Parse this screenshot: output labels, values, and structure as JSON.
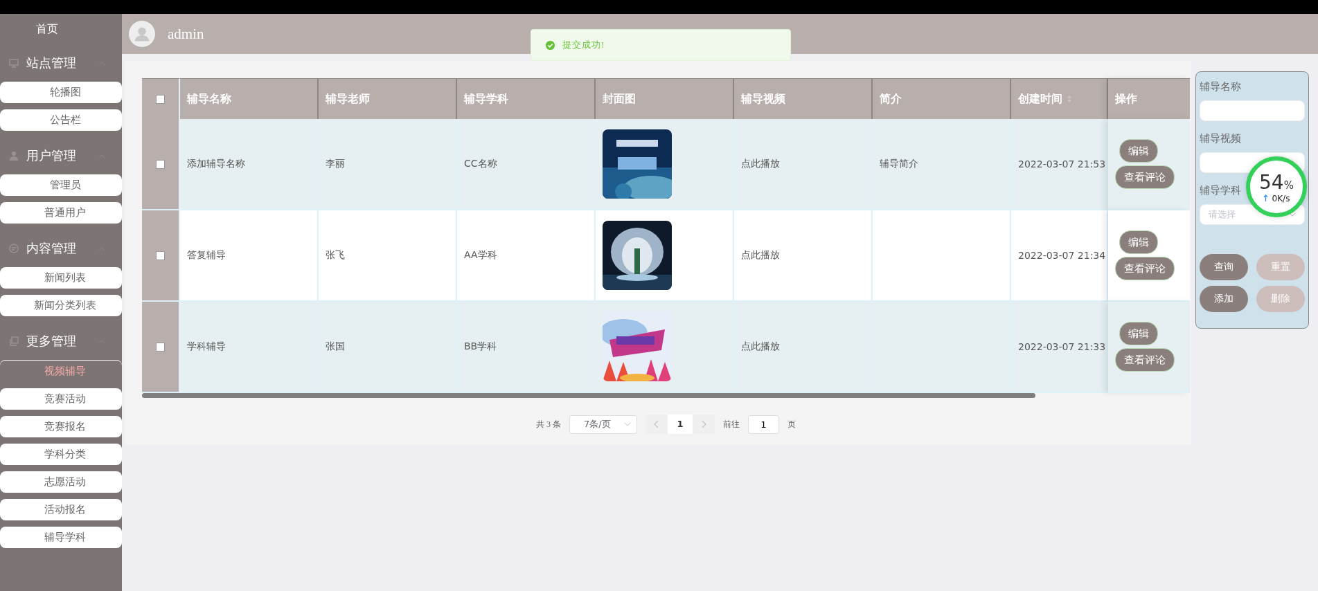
{
  "sidebar": {
    "home": "首页",
    "groups": [
      {
        "title": "站点管理",
        "expanded": true,
        "items": [
          {
            "label": "轮播图",
            "selected": false
          },
          {
            "label": "公告栏",
            "selected": false
          }
        ]
      },
      {
        "title": "用户管理",
        "expanded": true,
        "items": [
          {
            "label": "管理员",
            "selected": false
          },
          {
            "label": "普通用户",
            "selected": false
          }
        ]
      },
      {
        "title": "内容管理",
        "expanded": true,
        "items": [
          {
            "label": "新闻列表",
            "selected": false
          },
          {
            "label": "新闻分类列表",
            "selected": false
          }
        ]
      },
      {
        "title": "更多管理",
        "expanded": true,
        "items": [
          {
            "label": "视频辅导",
            "selected": true
          },
          {
            "label": "竞赛活动",
            "selected": false
          },
          {
            "label": "竞赛报名",
            "selected": false
          },
          {
            "label": "学科分类",
            "selected": false
          },
          {
            "label": "志愿活动",
            "selected": false
          },
          {
            "label": "活动报名",
            "selected": false
          },
          {
            "label": "辅导学科",
            "selected": false
          }
        ]
      }
    ]
  },
  "header": {
    "username": "admin"
  },
  "toast": {
    "message": "提交成功!"
  },
  "table": {
    "select_all": false,
    "columns": [
      {
        "label": "辅导名称",
        "sortable": false
      },
      {
        "label": "辅导老师",
        "sortable": false
      },
      {
        "label": "辅导学科",
        "sortable": false
      },
      {
        "label": "封面图",
        "sortable": false
      },
      {
        "label": "辅导视频",
        "sortable": false
      },
      {
        "label": "简介",
        "sortable": false
      },
      {
        "label": "创建时间",
        "sortable": true
      },
      {
        "label": "操作",
        "sortable": false
      }
    ],
    "rows": [
      {
        "checked": false,
        "name": "添加辅导名称",
        "teacher": "李丽",
        "subject": "CC名称",
        "video": "点此播放",
        "intro": "辅导简介",
        "created": "2022-03-07 21:53",
        "actions": [
          "编辑",
          "查看评论"
        ]
      },
      {
        "checked": false,
        "name": "答复辅导",
        "teacher": "张飞",
        "subject": "AA学科",
        "video": "点此播放",
        "created": "2022-03-07 21:34",
        "actions": [
          "编辑",
          "查看评论"
        ]
      },
      {
        "checked": false,
        "name": "学科辅导",
        "teacher": "张国",
        "subject": "BB学科",
        "video": "点此播放",
        "created": "2022-03-07 21:33",
        "actions": [
          "编辑",
          "查看评论"
        ]
      }
    ]
  },
  "pagination": {
    "total": "共 3 条",
    "page_size": "7条/页",
    "pages": [
      {
        "label": "1",
        "selected": true
      }
    ],
    "goto_label": "前往",
    "goto_value": "1",
    "goto_suffix": "页"
  },
  "search": {
    "fields": [
      {
        "label": "辅导名称",
        "kind": "input"
      },
      {
        "label": "辅导视频",
        "kind": "input"
      },
      {
        "label": "辅导学科",
        "kind": "select",
        "placeholder": "请选择"
      }
    ],
    "buttons": [
      {
        "label": "查询",
        "kind": "primary"
      },
      {
        "label": "重置",
        "kind": "muted"
      },
      {
        "label": "添加",
        "kind": "primary"
      },
      {
        "label": "删除",
        "kind": "muted"
      }
    ]
  },
  "speed_widget": {
    "percent": "54",
    "unit": "%",
    "rate": "0K/s"
  }
}
